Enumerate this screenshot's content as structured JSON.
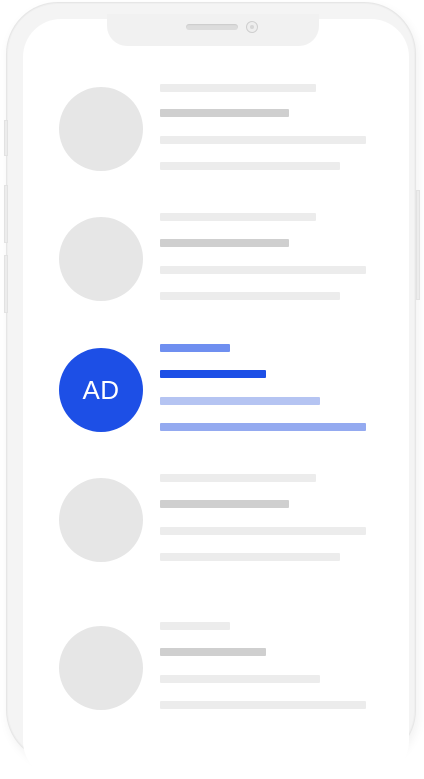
{
  "active_contact": {
    "initials": "AD"
  },
  "colors": {
    "placeholder_light": "#ececec",
    "placeholder_mid": "#cfcfcf",
    "accent": "#1d4fe6",
    "accent_light": "#6f8ff0",
    "accent_pale": "#b5c4f2",
    "accent_soft": "#94aaf0",
    "avatar_placeholder": "#e6e6e6"
  },
  "contacts": [
    {
      "state": "placeholder",
      "initials": ""
    },
    {
      "state": "placeholder",
      "initials": ""
    },
    {
      "state": "active",
      "initials": "AD"
    },
    {
      "state": "placeholder",
      "initials": ""
    },
    {
      "state": "placeholder",
      "initials": ""
    }
  ]
}
